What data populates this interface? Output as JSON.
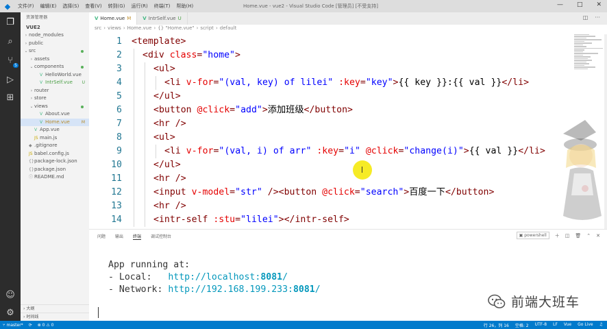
{
  "titlebar": {
    "menu": [
      "文件(F)",
      "编辑(E)",
      "选择(S)",
      "查看(V)",
      "转到(G)",
      "运行(R)",
      "终端(T)",
      "帮助(H)"
    ],
    "window_title": "Home.vue - vue2 - Visual Studio Code [管理员] [不受支持]",
    "controls": [
      "—",
      "□",
      "✕"
    ]
  },
  "sidebar": {
    "title": "资源管理器",
    "project": "VUE2",
    "items": [
      {
        "label": "node_modules",
        "depth": 0,
        "twisty": "›",
        "icon": ""
      },
      {
        "label": "public",
        "depth": 0,
        "twisty": "›",
        "icon": ""
      },
      {
        "label": "src",
        "depth": 0,
        "twisty": "⌄",
        "icon": "",
        "status_dot": true
      },
      {
        "label": "assets",
        "depth": 1,
        "twisty": "›",
        "icon": ""
      },
      {
        "label": "components",
        "depth": 1,
        "twisty": "⌄",
        "icon": "",
        "status_dot": true
      },
      {
        "label": "HelloWorld.vue",
        "depth": 2,
        "twisty": "",
        "icon": "V"
      },
      {
        "label": "IntrSelf.vue",
        "depth": 2,
        "twisty": "",
        "icon": "V",
        "status": "U"
      },
      {
        "label": "router",
        "depth": 1,
        "twisty": "›",
        "icon": ""
      },
      {
        "label": "store",
        "depth": 1,
        "twisty": "›",
        "icon": ""
      },
      {
        "label": "views",
        "depth": 1,
        "twisty": "⌄",
        "icon": "",
        "status_dot": true
      },
      {
        "label": "About.vue",
        "depth": 2,
        "twisty": "",
        "icon": "V"
      },
      {
        "label": "Home.vue",
        "depth": 2,
        "twisty": "",
        "icon": "V",
        "status": "M",
        "selected": true
      },
      {
        "label": "App.vue",
        "depth": 1,
        "twisty": "",
        "icon": "V"
      },
      {
        "label": "main.js",
        "depth": 1,
        "twisty": "",
        "icon": "JS"
      },
      {
        "label": ".gitignore",
        "depth": 0,
        "twisty": "",
        "icon": "◆"
      },
      {
        "label": "babel.config.js",
        "depth": 0,
        "twisty": "",
        "icon": "JS"
      },
      {
        "label": "package-lock.json",
        "depth": 0,
        "twisty": "",
        "icon": "{}"
      },
      {
        "label": "package.json",
        "depth": 0,
        "twisty": "",
        "icon": "{}"
      },
      {
        "label": "README.md",
        "depth": 0,
        "twisty": "",
        "icon": "ⓘ"
      }
    ],
    "outline_label": "大纲",
    "timeline_label": "时间线"
  },
  "tabs": [
    {
      "label": "Home.vue",
      "status": "M",
      "active": true
    },
    {
      "label": "IntrSelf.vue",
      "status": "U",
      "active": false
    }
  ],
  "breadcrumb": [
    "src",
    "views",
    "Home.vue",
    "{} \"Home.vue\"",
    "script",
    "default"
  ],
  "editor": {
    "lines": [
      {
        "n": "1",
        "indent": 0,
        "tokens": [
          [
            "tag",
            "<template>"
          ]
        ]
      },
      {
        "n": "2",
        "indent": 1,
        "tokens": [
          [
            "tag",
            "<div "
          ],
          [
            "attr",
            "class"
          ],
          [
            "punct",
            "="
          ],
          [
            "val",
            "\"home\""
          ],
          [
            "tag",
            ">"
          ]
        ]
      },
      {
        "n": "3",
        "indent": 2,
        "tokens": [
          [
            "tag",
            "<ul>"
          ]
        ]
      },
      {
        "n": "4",
        "indent": 3,
        "tokens": [
          [
            "tag",
            "<li "
          ],
          [
            "attr",
            "v-for"
          ],
          [
            "punct",
            "="
          ],
          [
            "val",
            "\"(val, key) of lilei\" "
          ],
          [
            "attr",
            ":key"
          ],
          [
            "punct",
            "="
          ],
          [
            "val",
            "\"key\""
          ],
          [
            "tag",
            ">"
          ],
          [
            "text",
            "{{ key }}:{{ val }}"
          ],
          [
            "tag",
            "</li>"
          ]
        ]
      },
      {
        "n": "5",
        "indent": 2,
        "tokens": [
          [
            "tag",
            "</ul>"
          ]
        ]
      },
      {
        "n": "6",
        "indent": 2,
        "tokens": [
          [
            "tag",
            "<button "
          ],
          [
            "attr",
            "@click"
          ],
          [
            "punct",
            "="
          ],
          [
            "val",
            "\"add\""
          ],
          [
            "tag",
            ">"
          ],
          [
            "text",
            "添加班级"
          ],
          [
            "tag",
            "</button>"
          ]
        ]
      },
      {
        "n": "7",
        "indent": 2,
        "tokens": [
          [
            "tag",
            "<hr />"
          ]
        ]
      },
      {
        "n": "8",
        "indent": 2,
        "tokens": [
          [
            "tag",
            "<ul>"
          ]
        ]
      },
      {
        "n": "9",
        "indent": 3,
        "tokens": [
          [
            "tag",
            "<li "
          ],
          [
            "attr",
            "v-for"
          ],
          [
            "punct",
            "="
          ],
          [
            "val",
            "\"(val, i) of arr\" "
          ],
          [
            "attr",
            ":key"
          ],
          [
            "punct",
            "="
          ],
          [
            "val",
            "\"i\" "
          ],
          [
            "attr",
            "@click"
          ],
          [
            "punct",
            "="
          ],
          [
            "val",
            "\"change(i)\""
          ],
          [
            "tag",
            ">"
          ],
          [
            "text",
            "{{ val }}"
          ],
          [
            "tag",
            "</li>"
          ]
        ]
      },
      {
        "n": "10",
        "indent": 2,
        "tokens": [
          [
            "tag",
            "</ul>"
          ]
        ]
      },
      {
        "n": "11",
        "indent": 2,
        "tokens": [
          [
            "tag",
            "<hr />"
          ]
        ]
      },
      {
        "n": "12",
        "indent": 2,
        "tokens": [
          [
            "tag",
            "<input "
          ],
          [
            "attr",
            "v-model"
          ],
          [
            "punct",
            "="
          ],
          [
            "val",
            "\"str\" "
          ],
          [
            "tag",
            "/><button "
          ],
          [
            "attr",
            "@click"
          ],
          [
            "punct",
            "="
          ],
          [
            "val",
            "\"search\""
          ],
          [
            "tag",
            ">"
          ],
          [
            "text",
            "百度一下"
          ],
          [
            "tag",
            "</button>"
          ]
        ]
      },
      {
        "n": "13",
        "indent": 2,
        "tokens": [
          [
            "tag",
            "<hr />"
          ]
        ]
      },
      {
        "n": "14",
        "indent": 2,
        "tokens": [
          [
            "tag",
            "<intr-self "
          ],
          [
            "attr",
            ":stu"
          ],
          [
            "punct",
            "="
          ],
          [
            "val",
            "\"lilei\""
          ],
          [
            "tag",
            "></intr-self>"
          ]
        ]
      }
    ]
  },
  "panel": {
    "tabs": [
      "问题",
      "输出",
      "终端",
      "调试控制台"
    ],
    "active_tab": "终端",
    "shell": "powershell",
    "terminal": {
      "line1": "App running at:",
      "local_label": "- Local:   ",
      "local_url": "http://localhost:",
      "local_port": "8081",
      "local_tail": "/",
      "network_label": "- Network: ",
      "network_url": "http://192.168.199.233:",
      "network_port": "8081",
      "network_tail": "/"
    }
  },
  "watermark": {
    "text": "前端大班车"
  },
  "statusbar": {
    "branch": "master*",
    "sync": "⟳",
    "errors": "⊗ 0 ⚠ 0",
    "position": "行 26，列 16",
    "spaces": "空格: 2",
    "encoding": "UTF-8",
    "eol": "LF",
    "language": "Vue",
    "golive": "Go Live"
  },
  "colors": {
    "accent": "#007acc",
    "vue_green": "#42b883",
    "tag": "#800000",
    "attr": "#e50000",
    "value": "#0000ff",
    "url": "#0598bc"
  }
}
